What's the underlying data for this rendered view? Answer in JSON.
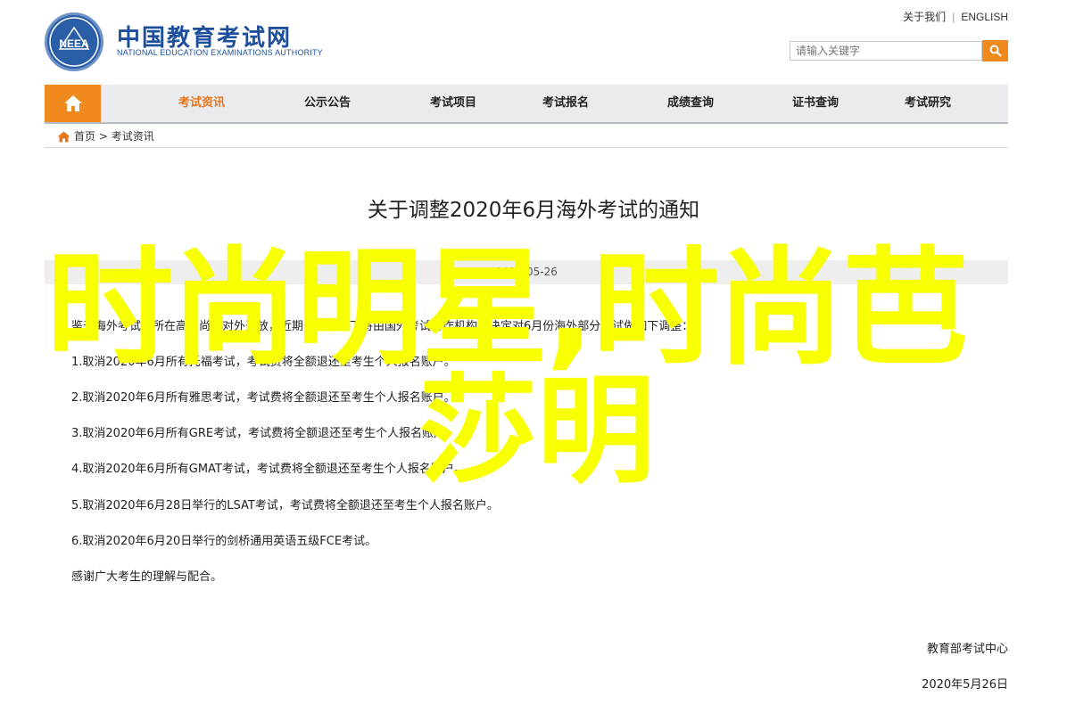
{
  "header": {
    "logo_cn": "中国教育考试网",
    "logo_en": "NATIONAL EDUCATION EXAMINATIONS AUTHORITY",
    "logo_mark_text": "NEEA",
    "links": {
      "about": "关于我们",
      "english": "ENGLISH"
    },
    "search": {
      "placeholder": "请输入关键字"
    }
  },
  "nav": {
    "items": [
      {
        "label": "考试资讯",
        "active": true
      },
      {
        "label": "公示公告"
      },
      {
        "label": "考试项目"
      },
      {
        "label": "考试报名"
      },
      {
        "label": "成绩查询"
      },
      {
        "label": "证书查询"
      },
      {
        "label": "考试研究"
      }
    ]
  },
  "breadcrumb": {
    "home": "首页",
    "separator": ">",
    "current": "考试资讯"
  },
  "article": {
    "title": "关于调整2020年6月海外考试的通知",
    "date": "2020-05-26",
    "intro": "鉴于海外考试点所在高校尚未对外开放，近期部分条件下将由国外考试合作机构，决定对6月份海外部分考试做如下调整：",
    "items": [
      "1.取消2020年6月所有托福考试，考试费将全额退还至考生个人报名账户。",
      "2.取消2020年6月所有雅思考试，考试费将全额退还至考生个人报名账户。",
      "3.取消2020年6月所有GRE考试，考试费将全额退还至考生个人报名账户。",
      "4.取消2020年6月所有GMAT考试，考试费将全额退还至考生个人报名账户。",
      "5.取消2020年6月28日举行的LSAT考试，考试费将全额退还至考生个人报名账户。",
      "6.取消2020年6月20日举行的剑桥通用英语五级FCE考试。"
    ],
    "thanks": "感谢广大考生的理解与配合。",
    "signature": "教育部考试中心",
    "sign_date": "2020年5月26日"
  },
  "overlay": {
    "line1": "时尚明星,时尚芭",
    "line2": "莎明",
    "color": "#f7ff00"
  },
  "colors": {
    "accent": "#f08a1f",
    "brand": "#1d4f9c"
  }
}
